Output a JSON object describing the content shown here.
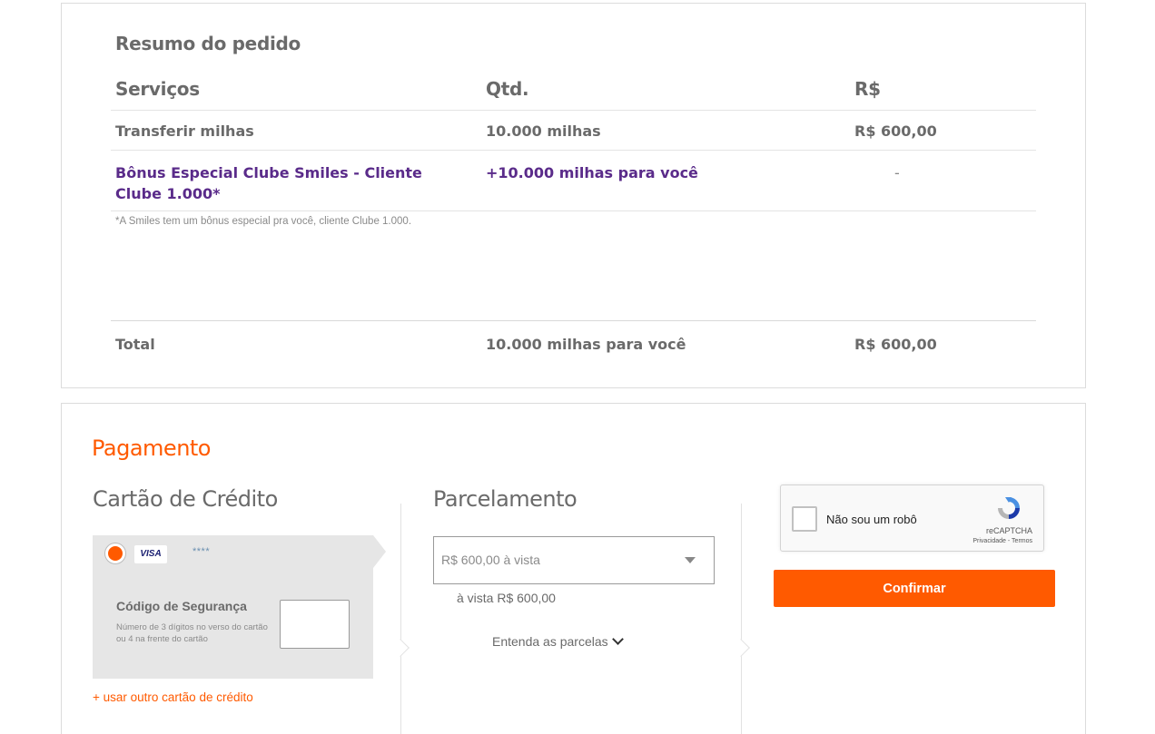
{
  "summary": {
    "title": "Resumo do pedido",
    "headers": {
      "service": "Serviços",
      "qty": "Qtd.",
      "price": "R$"
    },
    "rows": [
      {
        "service": "Transferir milhas",
        "qty": "10.000 milhas",
        "price": "R$ 600,00"
      },
      {
        "service": "Bônus Especial Clube Smiles - Cliente Clube 1.000*",
        "qty": "+10.000 milhas para você",
        "price": "-"
      }
    ],
    "footnote": "*A Smiles tem um bônus especial pra você, cliente Clube 1.000.",
    "total": {
      "label": "Total",
      "qty": "10.000 milhas para você",
      "price": "R$ 600,00"
    }
  },
  "payment": {
    "title": "Pagamento",
    "credit_card": {
      "title": "Cartão de Crédito",
      "brand": "VISA",
      "masked_number": "****",
      "cvv_label": "Código de Segurança",
      "cvv_hint": "Número de 3 dígitos no verso do cartão ou 4 na frente do cartão",
      "other_card_link": "+ usar outro cartão de crédito"
    },
    "installments": {
      "title": "Parcelamento",
      "selected": "R$ 600,00 à vista",
      "summary": "à vista R$ 600,00",
      "understand_link": "Entenda as parcelas"
    },
    "recaptcha": {
      "label": "Não sou um robô",
      "brand": "reCAPTCHA",
      "links": "Privacidade - Termos"
    },
    "confirm_label": "Confirmar"
  },
  "colors": {
    "accent": "#ff5a00",
    "bonus_text": "#5a2b8a",
    "text": "#6a6a6a"
  }
}
